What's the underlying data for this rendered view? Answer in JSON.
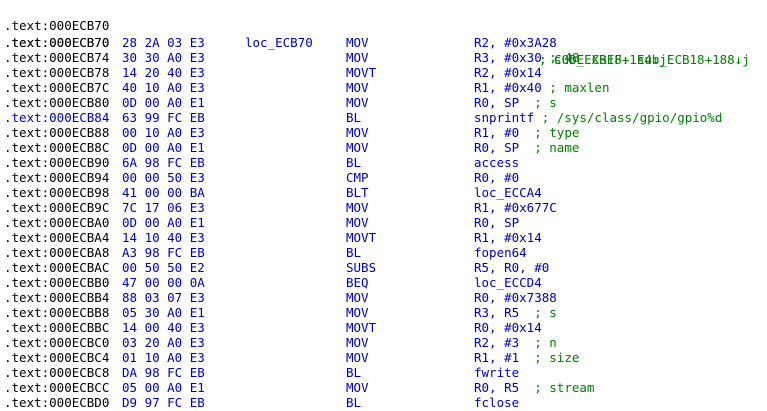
{
  "listing": {
    "header": [
      {
        "addr": ".text:000ECB70",
        "label": "loc_ECB70",
        "xref": "; CODE XREF: sub_ECB18+188↓j"
      },
      {
        "addr": ".text:000ECB70",
        "label": "",
        "xref": "; sub_ECB18+1E4↓j"
      }
    ],
    "rows": [
      {
        "addr": ".text:000ECB70",
        "bytes": "28 2A 03 E3",
        "mnem": "MOV",
        "ops": "R2, #0x3A28",
        "cmt": ""
      },
      {
        "addr": ".text:000ECB74",
        "bytes": "30 30 A0 E3",
        "mnem": "MOV",
        "ops": "R3, #0x30 ",
        "cmt": "; 48"
      },
      {
        "addr": ".text:000ECB78",
        "bytes": "14 20 40 E3",
        "mnem": "MOVT",
        "ops": "R2, #0x14",
        "cmt": ""
      },
      {
        "addr": ".text:000ECB7C",
        "bytes": "40 10 A0 E3",
        "mnem": "MOV",
        "ops": "R1, #0x40 ",
        "cmt": "; maxlen"
      },
      {
        "addr": ".text:000ECB80",
        "bytes": "0D 00 A0 E1",
        "mnem": "MOV",
        "ops": "R0, SP  ",
        "cmt": "; s"
      },
      {
        "addr": ".text:000ECB84",
        "bytes": "63 99 FC EB",
        "mnem": "BL",
        "ops": "snprintf ",
        "cmt": "; /sys/class/gpio/gpio%d",
        "hl": true
      },
      {
        "addr": ".text:000ECB88",
        "bytes": "00 10 A0 E3",
        "mnem": "MOV",
        "ops": "R1, #0  ",
        "cmt": "; type"
      },
      {
        "addr": ".text:000ECB8C",
        "bytes": "0D 00 A0 E1",
        "mnem": "MOV",
        "ops": "R0, SP  ",
        "cmt": "; name"
      },
      {
        "addr": ".text:000ECB90",
        "bytes": "6A 98 FC EB",
        "mnem": "BL",
        "ops": "access",
        "cmt": ""
      },
      {
        "addr": ".text:000ECB94",
        "bytes": "00 00 50 E3",
        "mnem": "CMP",
        "ops": "R0, #0",
        "cmt": ""
      },
      {
        "addr": ".text:000ECB98",
        "bytes": "41 00 00 BA",
        "mnem": "BLT",
        "ops": "loc_ECCA4",
        "cmt": ""
      },
      {
        "addr": ".text:000ECB9C",
        "bytes": "7C 17 06 E3",
        "mnem": "MOV",
        "ops": "R1, #0x677C",
        "cmt": ""
      },
      {
        "addr": ".text:000ECBA0",
        "bytes": "0D 00 A0 E1",
        "mnem": "MOV",
        "ops": "R0, SP",
        "cmt": ""
      },
      {
        "addr": ".text:000ECBA4",
        "bytes": "14 10 40 E3",
        "mnem": "MOVT",
        "ops": "R1, #0x14",
        "cmt": ""
      },
      {
        "addr": ".text:000ECBA8",
        "bytes": "A3 98 FC EB",
        "mnem": "BL",
        "ops": "fopen64",
        "cmt": ""
      },
      {
        "addr": ".text:000ECBAC",
        "bytes": "00 50 50 E2",
        "mnem": "SUBS",
        "ops": "R5, R0, #0",
        "cmt": ""
      },
      {
        "addr": ".text:000ECBB0",
        "bytes": "47 00 00 0A",
        "mnem": "BEQ",
        "ops": "loc_ECCD4",
        "cmt": ""
      },
      {
        "addr": ".text:000ECBB4",
        "bytes": "88 03 07 E3",
        "mnem": "MOV",
        "ops": "R0, #0x7388",
        "cmt": ""
      },
      {
        "addr": ".text:000ECBB8",
        "bytes": "05 30 A0 E1",
        "mnem": "MOV",
        "ops": "R3, R5  ",
        "cmt": "; s"
      },
      {
        "addr": ".text:000ECBBC",
        "bytes": "14 00 40 E3",
        "mnem": "MOVT",
        "ops": "R0, #0x14",
        "cmt": ""
      },
      {
        "addr": ".text:000ECBC0",
        "bytes": "03 20 A0 E3",
        "mnem": "MOV",
        "ops": "R2, #3  ",
        "cmt": "; n"
      },
      {
        "addr": ".text:000ECBC4",
        "bytes": "01 10 A0 E3",
        "mnem": "MOV",
        "ops": "R1, #1  ",
        "cmt": "; size"
      },
      {
        "addr": ".text:000ECBC8",
        "bytes": "DA 98 FC EB",
        "mnem": "BL",
        "ops": "fwrite",
        "cmt": ""
      },
      {
        "addr": ".text:000ECBCC",
        "bytes": "05 00 A0 E1",
        "mnem": "MOV",
        "ops": "R0, R5  ",
        "cmt": "; stream"
      },
      {
        "addr": ".text:000ECBD0",
        "bytes": "D9 97 FC EB",
        "mnem": "BL",
        "ops": "fclose",
        "cmt": ""
      }
    ]
  }
}
